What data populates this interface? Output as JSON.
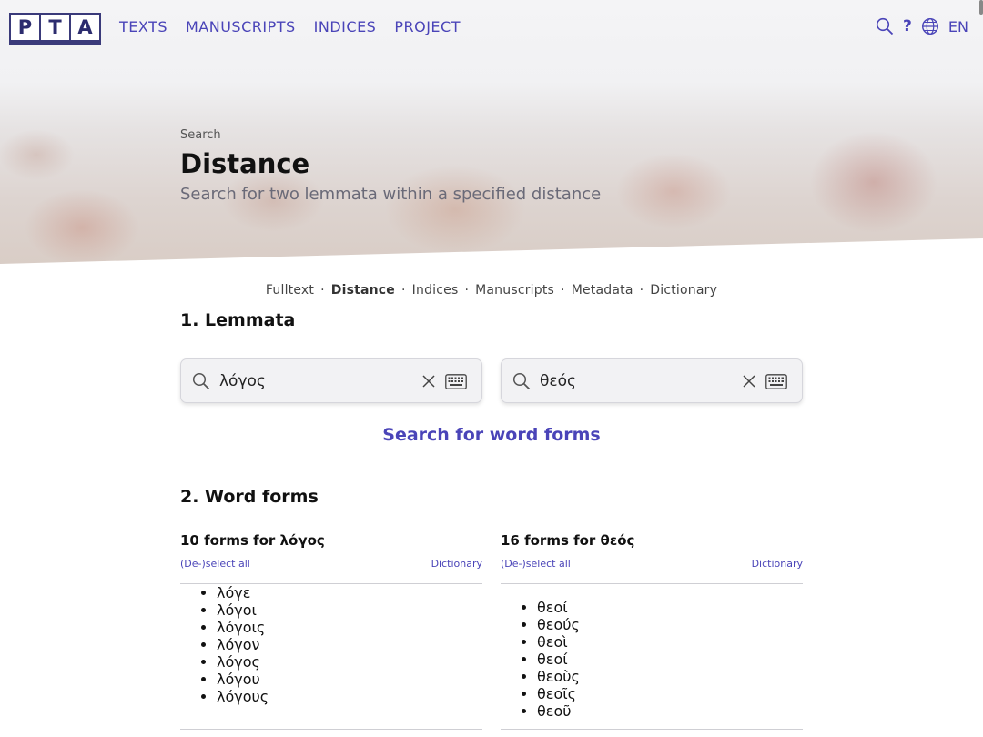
{
  "nav": {
    "logo": [
      "P",
      "T",
      "A"
    ],
    "items": [
      "TEXTS",
      "MANUSCRIPTS",
      "INDICES",
      "PROJECT"
    ],
    "help": "?",
    "language": "EN",
    "icons": [
      "search-icon",
      "globe-icon"
    ]
  },
  "hero": {
    "breadcrumb": "Search",
    "title": "Distance",
    "subtitle": "Search for two lemmata within a specified distance"
  },
  "search_tabs": [
    "Fulltext",
    "Distance",
    "Indices",
    "Manuscripts",
    "Metadata",
    "Dictionary"
  ],
  "active_tab": "Distance",
  "lemmata": {
    "title": "1.  Lemmata",
    "inputs": [
      {
        "value": "λόγος"
      },
      {
        "value": "θεός"
      }
    ],
    "button": "Search for word forms"
  },
  "wordforms": {
    "title": "2.  Word forms",
    "columns": [
      {
        "heading": "10 forms for λόγος",
        "select_all": "(De-)select all",
        "dictionary": "Dictionary",
        "forms": [
          "λόγε",
          "λόγοι",
          "λόγοις",
          "λόγον",
          "λόγος",
          "λόγου",
          "λόγους"
        ]
      },
      {
        "heading": "16 forms for θεός",
        "select_all": "(De-)select all",
        "dictionary": "Dictionary",
        "forms": [
          "θεοί",
          "θεούς",
          "θεοὶ",
          "θεοί",
          "θεοὺς",
          "θεοῖς",
          "θεοῦ"
        ]
      }
    ]
  },
  "colors": {
    "accent": "#4a44b8",
    "dot": "#5b55d8"
  }
}
